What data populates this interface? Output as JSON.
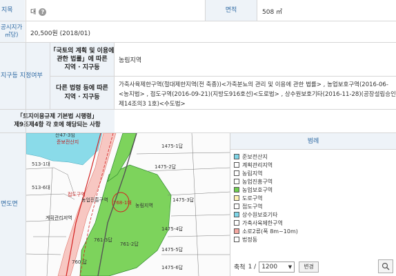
{
  "row1": {
    "label_jimok": "지목",
    "jimok_value": "대",
    "help_glyph": "?",
    "label_area": "면적",
    "area_value": "508 ㎡"
  },
  "row2": {
    "label_price": "공시지가\n㎡당)",
    "price_value": "20,500원 (2018/01)"
  },
  "zone": {
    "label": "지구등 지정여부",
    "law1_label": "「국토의 계획 및 이용에\n관한 법률」에 따른\n지역 · 지구등",
    "law1_value": "농림지역",
    "law2_label": "다른 법령 등에 따른\n지역 · 지구등",
    "law2_line1": "가축사육제한구역(절대제한지역(전 축종))<가축분뇨의 관리 및 이용에 관한 법률> , 농업보호구역(2016-06-",
    "law2_line2": "<농지법> , 접도구역(2016-09-21)(지방도916호선)<도로법> , 상수원보호기타(2016-11-28)(공장설립승인지",
    "law2_line3": "제14조의3 1호)<수도법>"
  },
  "regulation": {
    "label": "「토지이용규제 기본법 시행령」\n제9조제4항 각 호에 해당되는 사항",
    "value": ""
  },
  "map": {
    "label": "면도면",
    "parcels": [
      "산47-3임",
      "513-1대",
      "513-6대",
      "1475-1답",
      "1475-2답",
      "1475-3답",
      "1475-4답",
      "1475-5답",
      "1475-6답",
      "768-1대",
      "760 답",
      "761-3답",
      "761-2답",
      "농림지역",
      "농업진흥구역",
      "계획관리지역",
      "준보전산지",
      "접도구역"
    ]
  },
  "legend": {
    "title": "범례",
    "items": [
      {
        "label": "준보전산지",
        "color": "#7fd6e8"
      },
      {
        "label": "계획관리지역",
        "color": "#ffffff"
      },
      {
        "label": "농림지역",
        "color": "#ffffff"
      },
      {
        "label": "농업진흥구역",
        "color": "#ffffff"
      },
      {
        "label": "농업보호구역",
        "color": "#6fcf4f"
      },
      {
        "label": "도로구역",
        "color": "#fff2b3"
      },
      {
        "label": "접도구역",
        "color": "#ffffff"
      },
      {
        "label": "상수원보호기타",
        "color": "#7fd6e8"
      },
      {
        "label": "가축사육제한구역",
        "color": "#ffffff"
      },
      {
        "label": "소로2류(폭 8m~10m)",
        "color": "#f4a7a0"
      },
      {
        "label": "법정동",
        "color": "#ffffff"
      }
    ],
    "scale_label": "축척",
    "scale_prefix": "1 /",
    "scale_value": "1200",
    "change_button": "변경"
  }
}
